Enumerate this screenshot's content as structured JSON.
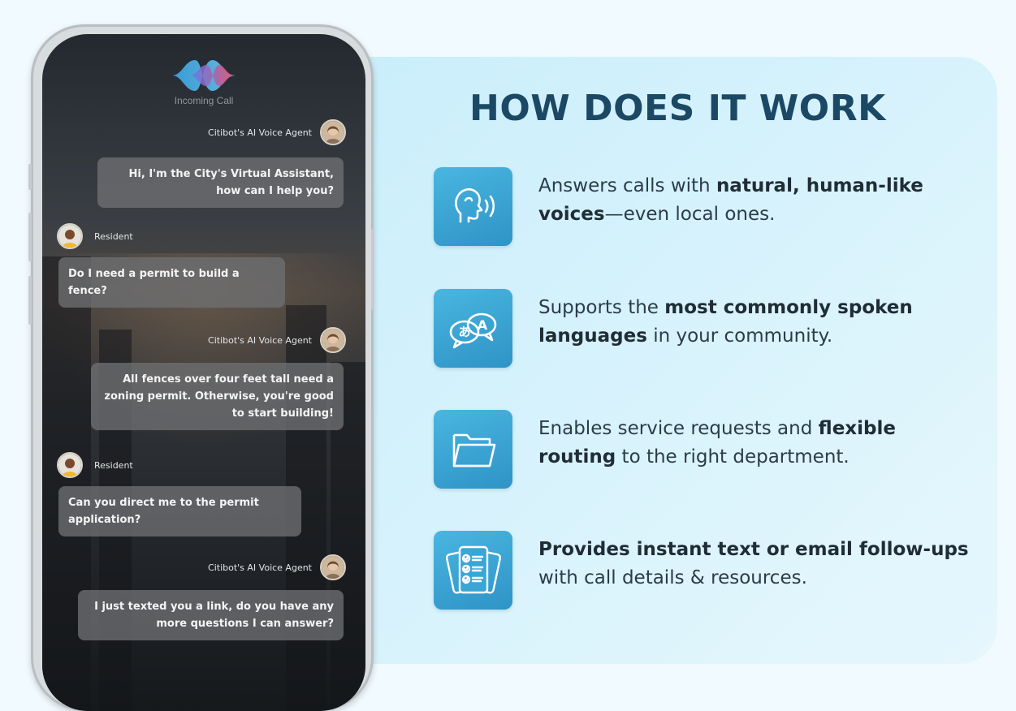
{
  "phone": {
    "status": "Incoming Call",
    "messages": [
      {
        "sender": "Citibot's AI Voice Agent",
        "text": "Hi, I'm the City's Virtual Assistant, how can I help you?"
      },
      {
        "sender": "Resident",
        "text": "Do I need a permit to build a fence?"
      },
      {
        "sender": "Citibot's AI Voice Agent",
        "text": "All fences over four feet tall need a zoning permit. Otherwise, you're good to start building!"
      },
      {
        "sender": "Resident",
        "text": "Can you direct me to the permit application?"
      },
      {
        "sender": "Citibot's AI Voice Agent",
        "text": "I just texted you a link, do you have any more questions I can answer?"
      }
    ]
  },
  "panel": {
    "title": "HOW DOES IT WORK",
    "features": [
      {
        "icon": "voice-head-icon",
        "parts": [
          {
            "t": "Answers calls with ",
            "b": false
          },
          {
            "t": "natural, human-like voices",
            "b": true
          },
          {
            "t": "—even local ones.",
            "b": false
          }
        ]
      },
      {
        "icon": "language-bubbles-icon",
        "parts": [
          {
            "t": "Supports the ",
            "b": false
          },
          {
            "t": "most commonly spoken languages",
            "b": true
          },
          {
            "t": " in your community.",
            "b": false
          }
        ]
      },
      {
        "icon": "folder-icon",
        "parts": [
          {
            "t": "Enables service requests and ",
            "b": false
          },
          {
            "t": "flexible routing",
            "b": true
          },
          {
            "t": " to the right department.",
            "b": false
          }
        ]
      },
      {
        "icon": "checklist-documents-icon",
        "parts": [
          {
            "t": "Provides instant text or email follow-ups",
            "b": true
          },
          {
            "t": " with call details & resources.",
            "b": false
          }
        ]
      }
    ]
  },
  "colors": {
    "title": "#1b4965",
    "tile": "#3aa6d6",
    "panel": "#cdeffb",
    "bubble": "#6e7072"
  }
}
